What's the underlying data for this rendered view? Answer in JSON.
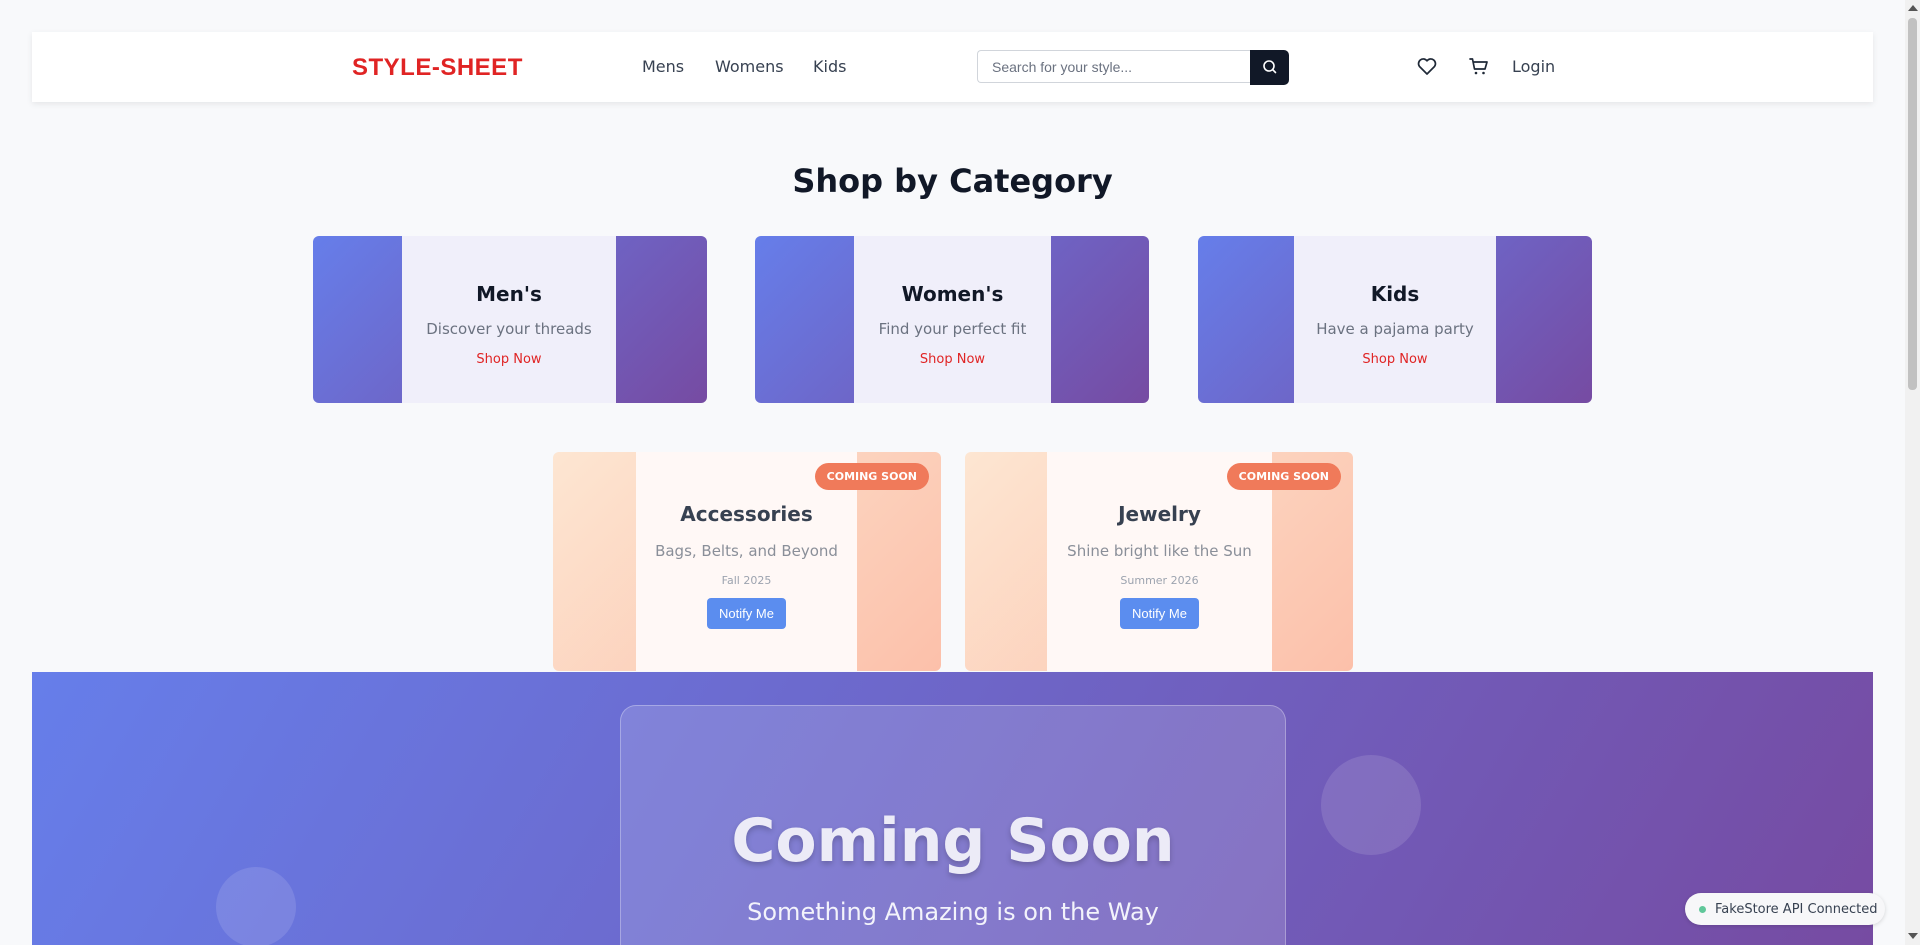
{
  "header": {
    "logo": "STYLE-SHEET",
    "nav": [
      "Mens",
      "Womens",
      "Kids"
    ],
    "search_placeholder": "Search for your style...",
    "login": "Login"
  },
  "categories": {
    "title": "Shop by Category",
    "items": [
      {
        "title": "Men's",
        "desc": "Discover your threads",
        "link": "Shop Now"
      },
      {
        "title": "Women's",
        "desc": "Find your perfect fit",
        "link": "Shop Now"
      },
      {
        "title": "Kids",
        "desc": "Have a pajama party",
        "link": "Shop Now"
      }
    ]
  },
  "upcoming": [
    {
      "badge": "COMING SOON",
      "title": "Accessories",
      "desc": "Bags, Belts, and Beyond",
      "date": "Fall 2025",
      "button": "Notify Me"
    },
    {
      "badge": "COMING SOON",
      "title": "Jewelry",
      "desc": "Shine bright like the Sun",
      "date": "Summer 2026",
      "button": "Notify Me"
    }
  ],
  "hero": {
    "title": "Coming Soon",
    "subtitle": "Something Amazing is on the Way"
  },
  "status": {
    "text": "FakeStore API Connected",
    "color": "#60c79a"
  },
  "colors": {
    "brand": "#e02424",
    "gradient_start": "#667eea",
    "gradient_end": "#764ba2",
    "notify": "#5b8def",
    "badge": "#f07a5a"
  },
  "icons": [
    "search-icon",
    "heart-icon",
    "cart-icon"
  ]
}
